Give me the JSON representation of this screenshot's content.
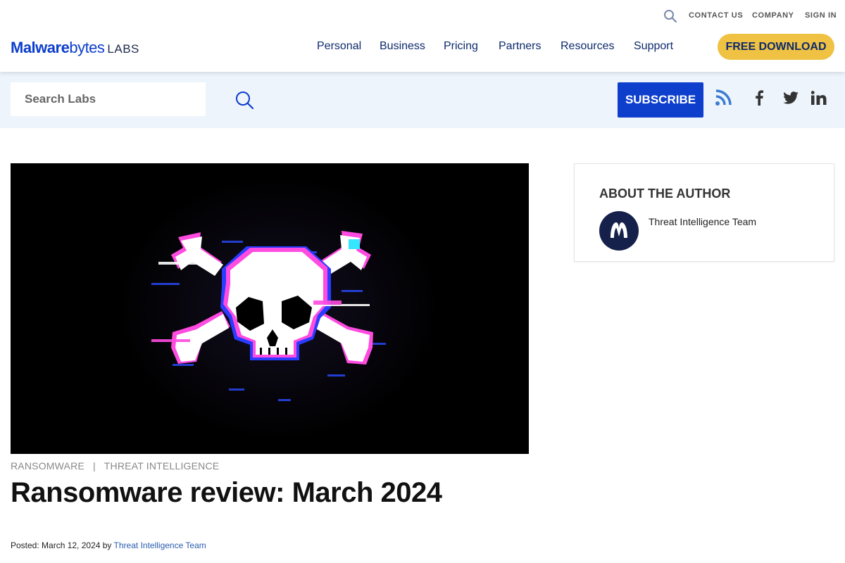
{
  "header": {
    "utility_links": [
      "CONTACT US",
      "COMPANY",
      "SIGN IN"
    ],
    "logo": {
      "brand_bold": "Malware",
      "brand_regular": "bytes",
      "suffix": "LABS"
    },
    "nav": [
      "Personal",
      "Business",
      "Pricing",
      "Partners",
      "Resources",
      "Support"
    ],
    "cta_label": "FREE DOWNLOAD",
    "cta_color": "#f0c243",
    "brand_color": "#0d3ecc"
  },
  "labs_band": {
    "search_placeholder": "Search Labs",
    "subscribe_label": "SUBSCRIBE",
    "social_icons": [
      "rss-icon",
      "facebook-icon",
      "twitter-icon",
      "linkedin-icon"
    ]
  },
  "article": {
    "categories": [
      "RANSOMWARE",
      "THREAT INTELLIGENCE"
    ],
    "category_separator": "|",
    "title": "Ransomware review: March 2024",
    "byline_prefix": "Posted: ",
    "date": "March 12, 2024",
    "byline_by": " by ",
    "author": "Threat Intelligence Team"
  },
  "sidebar": {
    "heading": "ABOUT THE AUTHOR",
    "author_name": "Threat Intelligence Team"
  }
}
